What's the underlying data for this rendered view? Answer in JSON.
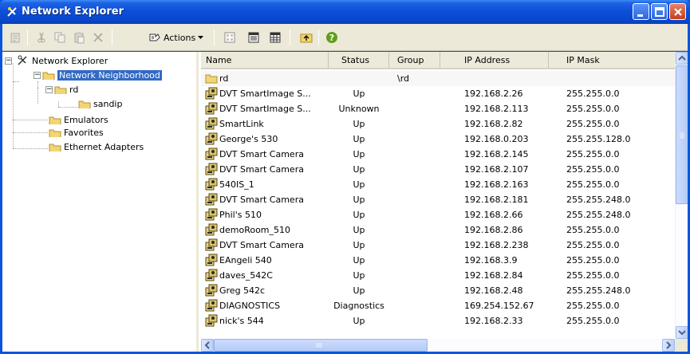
{
  "window": {
    "title": "Network Explorer",
    "colors": {
      "titlebar": "#0a48cf",
      "selection": "#316ac5",
      "toolbar": "#ece9d8"
    }
  },
  "toolbar": {
    "actions_label": "Actions",
    "icons": [
      "properties-icon",
      "cut-icon",
      "copy-icon",
      "paste-icon",
      "delete-icon",
      "actions-icon",
      "large-icons-icon",
      "details-icon",
      "list-icon",
      "up-folder-icon",
      "help-icon"
    ]
  },
  "tree": {
    "root": "Network Explorer",
    "network_neighborhood": "Network Neighborhood",
    "rd": "rd",
    "sandip": "sandip",
    "emulators": "Emulators",
    "favorites": "Favorites",
    "ethernet_adapters": "Ethernet Adapters"
  },
  "list": {
    "columns": [
      "Name",
      "Status",
      "Group",
      "IP Address",
      "IP Mask"
    ],
    "folder_row": {
      "name": "rd",
      "group": "\\rd"
    },
    "rows": [
      {
        "name": "DVT SmartImage S...",
        "status": "Up",
        "ip": "192.168.2.26",
        "mask": "255.255.0.0"
      },
      {
        "name": "DVT SmartImage S...",
        "status": "Unknown",
        "ip": "192.168.2.113",
        "mask": "255.255.0.0"
      },
      {
        "name": "SmartLink",
        "status": "Up",
        "ip": "192.168.2.82",
        "mask": "255.255.0.0"
      },
      {
        "name": "George's 530",
        "status": "Up",
        "ip": "192.168.0.203",
        "mask": "255.255.128.0"
      },
      {
        "name": "DVT Smart Camera",
        "status": "Up",
        "ip": "192.168.2.145",
        "mask": "255.255.0.0"
      },
      {
        "name": "DVT Smart Camera",
        "status": "Up",
        "ip": "192.168.2.107",
        "mask": "255.255.0.0"
      },
      {
        "name": "540IS_1",
        "status": "Up",
        "ip": "192.168.2.163",
        "mask": "255.255.0.0"
      },
      {
        "name": "DVT Smart Camera",
        "status": "Up",
        "ip": "192.168.2.181",
        "mask": "255.255.248.0"
      },
      {
        "name": "Phil's 510",
        "status": "Up",
        "ip": "192.168.2.66",
        "mask": "255.255.248.0"
      },
      {
        "name": "demoRoom_510",
        "status": "Up",
        "ip": "192.168.2.86",
        "mask": "255.255.0.0"
      },
      {
        "name": "DVT Smart Camera",
        "status": "Up",
        "ip": "192.168.2.238",
        "mask": "255.255.0.0"
      },
      {
        "name": "EAngeli 540",
        "status": "Up",
        "ip": "192.168.3.9",
        "mask": "255.255.0.0"
      },
      {
        "name": "daves_542C",
        "status": "Up",
        "ip": "192.168.2.84",
        "mask": "255.255.0.0"
      },
      {
        "name": "Greg 542c",
        "status": "Up",
        "ip": "192.168.2.48",
        "mask": "255.255.248.0"
      },
      {
        "name": "DIAGNOSTICS",
        "status": "Diagnostics",
        "ip": "169.254.152.67",
        "mask": "255.255.0.0"
      },
      {
        "name": "nick's 544",
        "status": "Up",
        "ip": "192.168.2.33",
        "mask": "255.255.0.0"
      }
    ]
  }
}
